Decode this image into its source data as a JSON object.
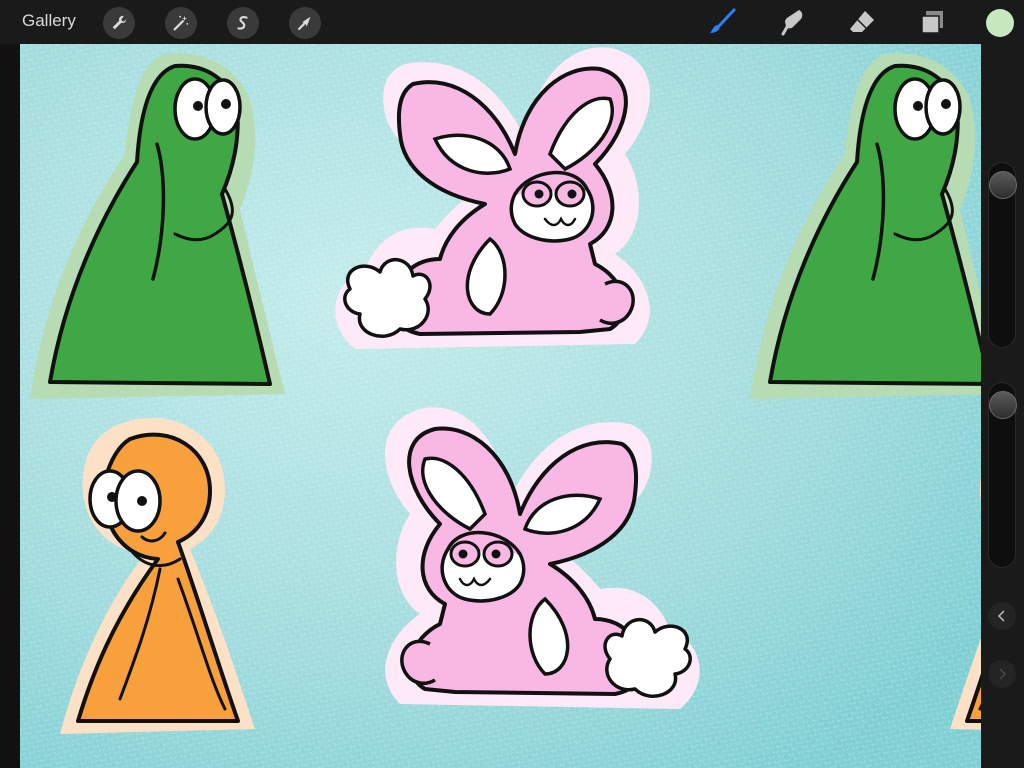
{
  "topbar": {
    "gallery_label": "Gallery",
    "actions": [
      "wrench-icon",
      "magic-wand-icon",
      "selection-s-icon",
      "transform-arrow-icon"
    ],
    "tools": [
      "brush-icon",
      "smudge-icon",
      "eraser-icon",
      "layers-icon"
    ],
    "active_tool": "brush-icon"
  },
  "colors": {
    "active_color": "#c8e8c0",
    "brush_active": "#2a7fff",
    "tool_icon": "#c8c8c8",
    "canvas_bg": "#a8dfe0",
    "green": "#3fa844",
    "green_outline": "#b7dbb3",
    "orange": "#f7a03c",
    "orange_outline": "#fde1c6",
    "pink": "#f9b7e4",
    "pink_outline": "#fde9f7"
  },
  "sidebar": {
    "brush_size": 0.95,
    "opacity": 0.95,
    "undo_icon": "chevron-left-icon",
    "redo_icon": "chevron-right-icon"
  }
}
